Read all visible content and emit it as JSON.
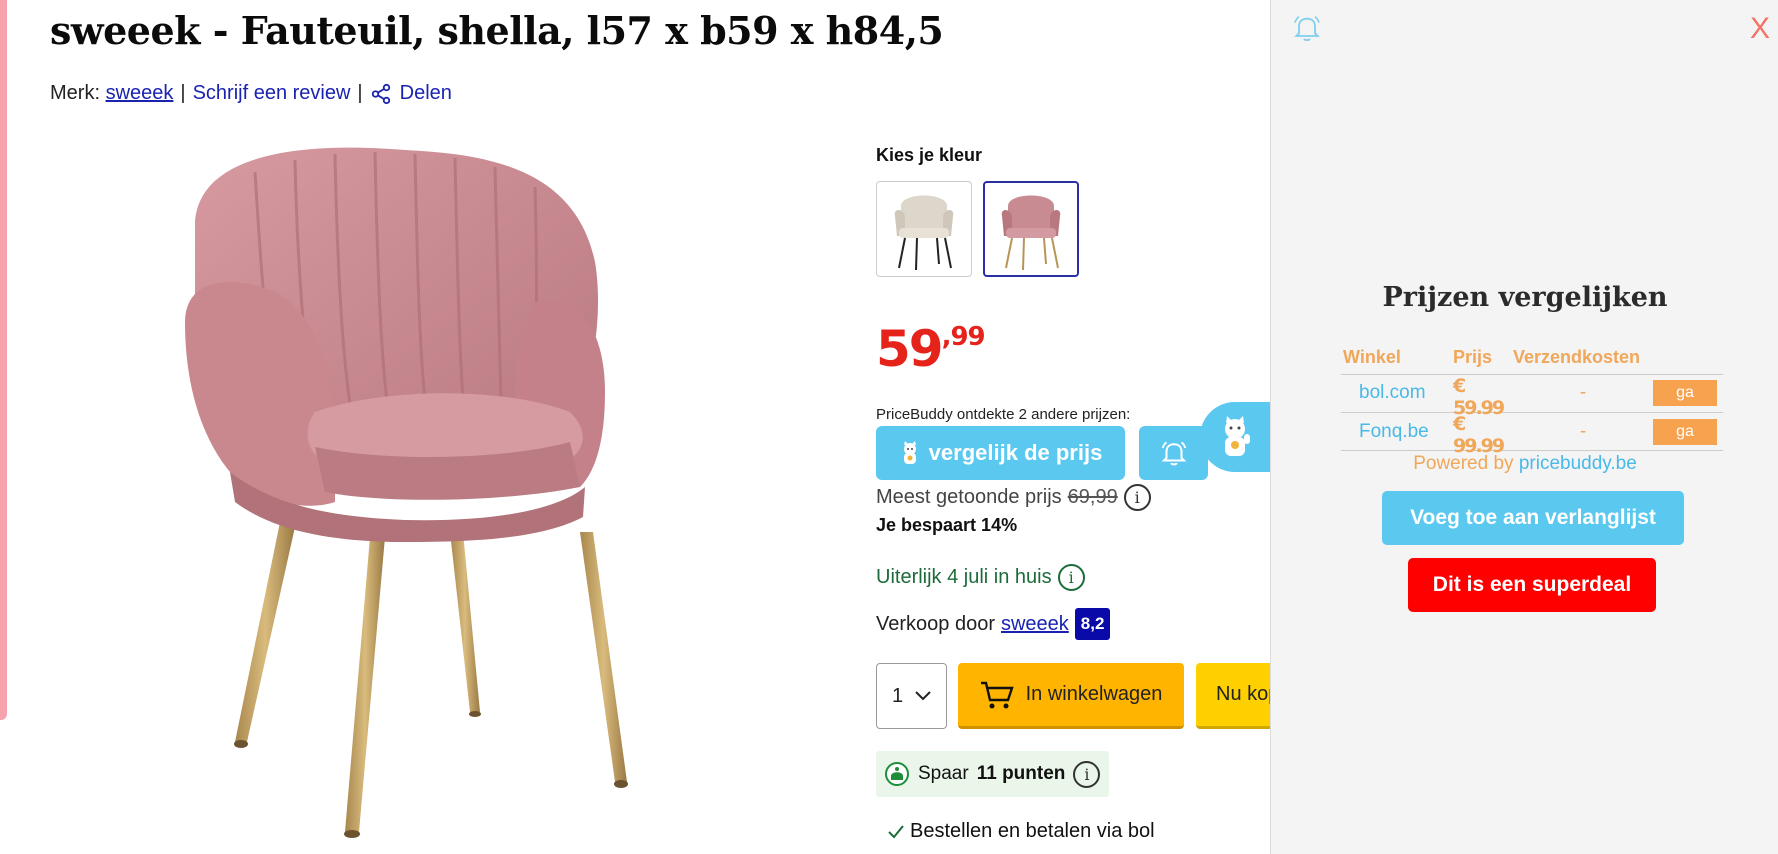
{
  "product": {
    "title": "sweeek - Fauteuil, shella, l57 x b59 x h84,5",
    "brand_label": "Merk:",
    "brand": "sweeek",
    "review_link": "Schrijf een review",
    "share_link": "Delen"
  },
  "colors": {
    "label": "Kies je kleur",
    "options": [
      "cream",
      "pink"
    ],
    "selected": "pink"
  },
  "price": {
    "euros": "59",
    "cents": ",99",
    "pricebuddy_note": "PriceBuddy ontdekte 2 andere prijzen:",
    "compare_button": "vergelijk de prijs",
    "most_shown_label": "Meest getoonde prijs",
    "most_shown_value": "69,99",
    "saving": "Je bespaart 14%"
  },
  "delivery": "Uiterlijk 4 juli in huis",
  "seller": {
    "label": "Verkoop door",
    "name": "sweeek",
    "rating": "8,2"
  },
  "cart": {
    "quantity": "1",
    "add_to_cart": "In winkelwagen",
    "buy_now": "Nu kopen"
  },
  "points": {
    "prefix": "Spaar",
    "value": "11 punten"
  },
  "order_note": "Bestellen en betalen via bol",
  "panel": {
    "title": "Prijzen vergelijken",
    "close": "X",
    "headers": [
      "Winkel",
      "Prijs",
      "Verzendkosten"
    ],
    "rows": [
      {
        "shop": "bol.com",
        "price": "€ 59.99",
        "shipping": "-",
        "action": "ga"
      },
      {
        "shop": "Fonq.be",
        "price": "€ 99.99",
        "shipping": "-",
        "action": "ga"
      }
    ],
    "powered_prefix": "Powered by",
    "powered_link": "pricebuddy.be",
    "wishlist_button": "Voeg toe aan verlanglijst",
    "deal_button": "Dit is een superdeal"
  },
  "accent_colors": {
    "price_red": "#e5231b",
    "pricebuddy_blue": "#5bc8f0",
    "cart_yellow": "#ffb400",
    "deal_red": "#ff0000"
  }
}
